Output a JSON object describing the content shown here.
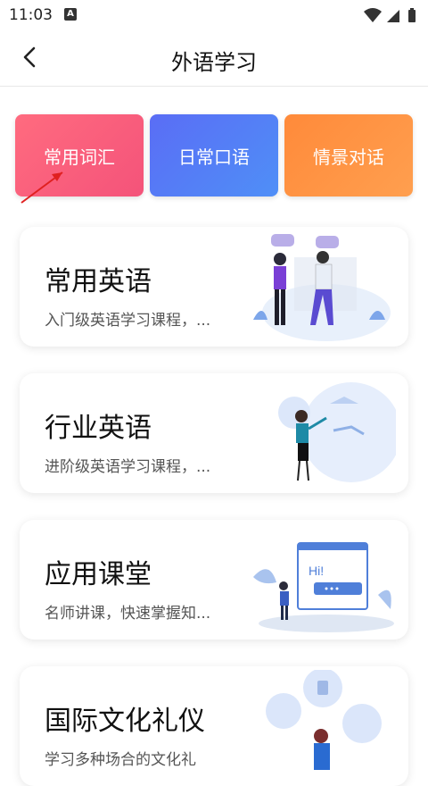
{
  "status": {
    "time": "11:03",
    "a_icon": "A"
  },
  "header": {
    "title": "外语学习"
  },
  "tiles": [
    {
      "label": "常用词汇",
      "color": "#f4537a"
    },
    {
      "label": "日常口语",
      "color": "#4f8ff7"
    },
    {
      "label": "情景对话",
      "color": "#ff9f4f"
    }
  ],
  "cards": [
    {
      "title": "常用英语",
      "desc": "入门级英语学习课程，..."
    },
    {
      "title": "行业英语",
      "desc": "进阶级英语学习课程，..."
    },
    {
      "title": "应用课堂",
      "desc": "名师讲课，快速掌握知..."
    },
    {
      "title": "国际文化礼仪",
      "desc": "学习多种场合的文化礼"
    }
  ],
  "icons": [
    "back-icon",
    "wifi-icon",
    "signal-icon",
    "battery-icon",
    "a-notification-icon"
  ],
  "illustrations": {
    "hi_text": "Hi!"
  }
}
